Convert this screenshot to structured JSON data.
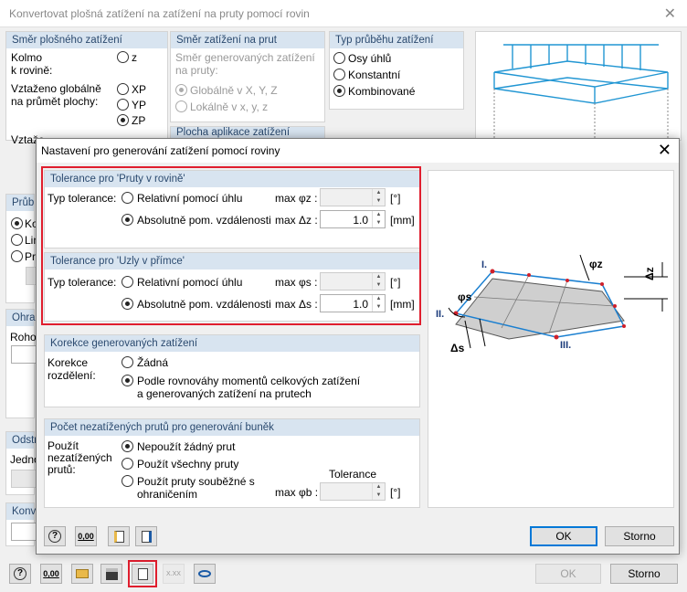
{
  "main": {
    "title": "Konvertovat plošná zatížení na zatížení na pruty pomocí rovin",
    "close": "✕",
    "smer_plosneho": {
      "header": "Směr plošného zatížení",
      "kolmo": "Kolmo\nk rovině:",
      "z": "z",
      "vztazeno": "Vztaženo globálně\nna průmět plochy:",
      "xp": "XP",
      "yp": "YP",
      "zp": "ZP",
      "vztazeno2": "Vztaže"
    },
    "smer_na_prut": {
      "header": "Směr zatížení na prut",
      "desc": "Směr generovaných zatížení na pruty:",
      "globalne": "Globálně v X, Y, Z",
      "lokalne": "Lokálně v x, y, z",
      "plocha": "Plocha aplikace zatížení"
    },
    "typ_prubehu": {
      "header": "Typ průběhu zatížení",
      "osy": "Osy úhlů",
      "konstantni": "Konstantní",
      "kombinovane": "Kombinované"
    },
    "left_fragments": {
      "prub": "Průb",
      "ko": "Ko",
      "lin": "Lin",
      "pr": "Pr",
      "ohran": "Ohran",
      "rohov": "Rohov",
      "odstr": "Odstr",
      "jedno": "Jedno",
      "konve": "Konve"
    },
    "ok": "OK",
    "storno": "Storno"
  },
  "dialog": {
    "title": "Nastavení pro generování zatížení pomocí roviny",
    "close": "✕",
    "tol_rovine": {
      "header": "Tolerance pro 'Pruty v rovině'",
      "typ": "Typ tolerance:",
      "relativni": "Relativní pomocí úhlu",
      "absolutne": "Absolutně pom. vzdálenosti",
      "max_phi": "max φz :",
      "max_delta": "max Δz :",
      "value_delta": "1.0",
      "unit_deg": "[°]",
      "unit_mm": "[mm]"
    },
    "tol_primce": {
      "header": "Tolerance pro 'Uzly v přímce'",
      "typ": "Typ tolerance:",
      "relativni": "Relativní pomocí úhlu",
      "absolutne": "Absolutně pom. vzdálenosti",
      "max_phi": "max φs :",
      "max_delta": "max Δs :",
      "value_delta": "1.0",
      "unit_deg": "[°]",
      "unit_mm": "[mm]"
    },
    "korekce": {
      "header": "Korekce generovaných zatížení",
      "label": "Korekce\nrozdělení:",
      "zadna": "Žádná",
      "podle": "Podle rovnováhy momentů celkových zatížení\na generovaných zatížení na prutech"
    },
    "pocet": {
      "header": "Počet nezatížených prutů pro generování buněk",
      "label": "Použít\nnezatížených\nprutů:",
      "nepouzit": "Nepoužít žádný prut",
      "vsechny": "Použít všechny pruty",
      "soubezne": "Použít pruty souběžné s\nohraničením",
      "tolerance": "Tolerance",
      "max_phi_b": "max φb :",
      "unit_deg": "[°]"
    },
    "diagram": {
      "label_I": "I.",
      "label_II": "II.",
      "label_III": "III.",
      "phi_z": "φz",
      "phi_s": "φs",
      "delta_z": "Δz",
      "delta_s": "Δs"
    },
    "ok": "OK",
    "storno": "Storno"
  },
  "icons": {
    "help": "?",
    "units": "0,00",
    "xxx": "X.XX"
  },
  "colors": {
    "accent_red": "#e01e2e",
    "group_header_bg": "#d8e4f0",
    "group_header_text": "#2b4a6f",
    "load_blue": "#2196d3"
  }
}
